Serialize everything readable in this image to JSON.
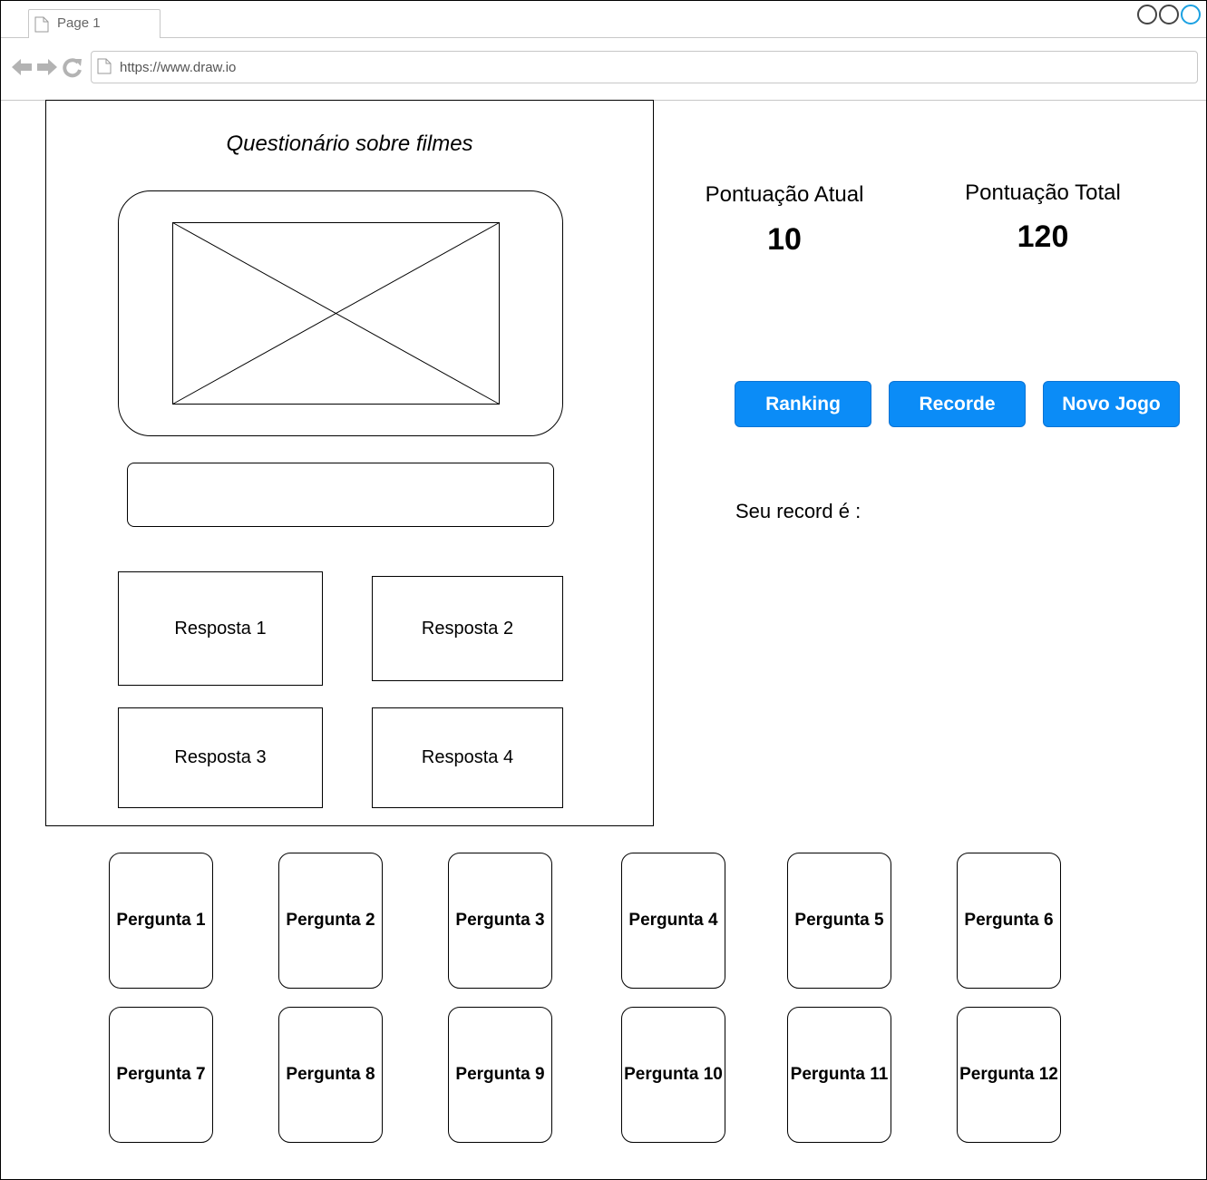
{
  "browser": {
    "tab_label": "Page 1",
    "url": "https://www.draw.io",
    "controls": [
      "window-button",
      "window-button",
      "window-button"
    ]
  },
  "quiz": {
    "title": "Questionário sobre filmes",
    "question_text": "",
    "answers": [
      "Resposta 1",
      "Resposta 2",
      "Resposta 3",
      "Resposta 4"
    ]
  },
  "scores": {
    "current_label": "Pontuação Atual",
    "current_value": "10",
    "total_label": "Pontuação Total",
    "total_value": "120"
  },
  "buttons": {
    "ranking": "Ranking",
    "recorde": "Recorde",
    "novo_jogo": "Novo Jogo",
    "color": "#0b8cf7"
  },
  "record": {
    "label": "Seu record é :"
  },
  "questions": [
    "Pergunta 1",
    "Pergunta 2",
    "Pergunta 3",
    "Pergunta 4",
    "Pergunta 5",
    "Pergunta 6",
    "Pergunta 7",
    "Pergunta 8",
    "Pergunta 9",
    "Pergunta 10",
    "Pergunta 11",
    "Pergunta 12"
  ]
}
